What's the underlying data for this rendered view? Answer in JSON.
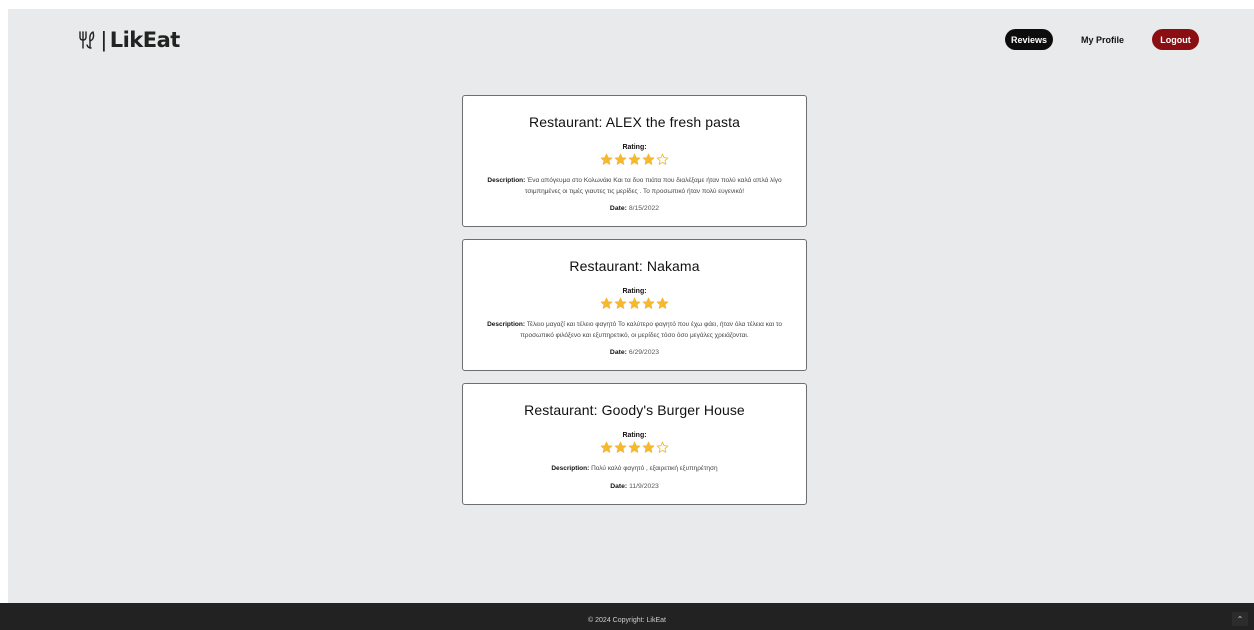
{
  "brand": {
    "name": "LikEat",
    "logo_icon": "fork-knife-icon"
  },
  "nav": {
    "reviews_label": "Reviews",
    "profile_label": "My Profile",
    "logout_label": "Logout"
  },
  "reviews": [
    {
      "title": "Restaurant: ALEX the fresh pasta",
      "rating_label": "Rating:",
      "rating": 4,
      "max_rating": 5,
      "description_label": "Description:",
      "description": "Ένα απόγευμα στο Κολωνάκι Και τα δυο πιάτα που διαλέξαμε ήταν πολύ καλά απλά λίγο τσιμπημένες οι τιμές γιαυτες τις μερίδες . Το προσωπικό ήταν πολύ ευγενικό!",
      "date_label": "Date:",
      "date": "8/15/2022"
    },
    {
      "title": "Restaurant: Nakama",
      "rating_label": "Rating:",
      "rating": 5,
      "max_rating": 5,
      "description_label": "Description:",
      "description": "Τέλειο μαγαζί και τέλειο φαγητό Το καλύτερο φαγητό που έχω φάει, ήταν όλα τέλεια και το προσωπικό φιλόξενο και εξυπηρετικό, οι μερίδες τόσο όσο μεγάλες χρειάζονται.",
      "date_label": "Date:",
      "date": "6/29/2023"
    },
    {
      "title": "Restaurant: Goody's Burger House",
      "rating_label": "Rating:",
      "rating": 4,
      "max_rating": 5,
      "description_label": "Description:",
      "description": "Πολύ καλό φαγητό , εξαιρετική εξυπηρέτηση",
      "date_label": "Date:",
      "date": "11/9/2023"
    }
  ],
  "footer": {
    "text": "© 2024 Copyright: LikEat"
  },
  "scroll_top": {
    "icon": "chevron-up-icon",
    "glyph": "⌃"
  },
  "colors": {
    "star": "#f5b82e",
    "logout": "#8b0f12",
    "reviews_button": "#0d0d0d",
    "footer": "#222222"
  }
}
